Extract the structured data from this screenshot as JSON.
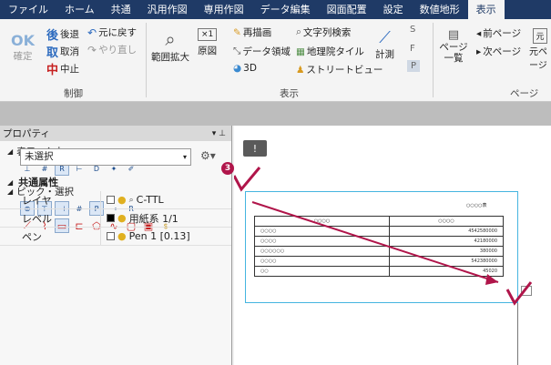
{
  "menubar": {
    "items": [
      "ファイル",
      "ホーム",
      "共通",
      "汎用作図",
      "専用作図",
      "データ編集",
      "図面配置",
      "設定",
      "数値地形",
      "表示"
    ],
    "active_index": 9
  },
  "ribbon": {
    "control": {
      "group_label": "制御",
      "ok_label": "OK",
      "confirm_label": "確定",
      "back_label": "後退",
      "undo_label": "元に戻す",
      "cancel_label": "取消",
      "redo_label": "やり直し",
      "abort_label": "中止",
      "back_mark": "後",
      "cancel_mark": "取",
      "abort_mark": "中"
    },
    "display": {
      "group_label": "表示",
      "zoom_range_label": "範囲拡大",
      "original_label": "原図",
      "original_icon_text": "×1",
      "redraw_label": "再描画",
      "text_search_label": "文字列検索",
      "data_area_label": "データ領域",
      "geo_tile_label": "地理院タイル",
      "view3d_label": "3D",
      "streetview_label": "ストリートビュー",
      "measure_label": "計測",
      "small_buttons": [
        "S",
        "F",
        "P"
      ]
    },
    "page": {
      "group_label": "ページ",
      "page_list_label": "ページ一覧",
      "prev_page_label": "前ページ",
      "next_page_label": "次ページ",
      "orig_page_label": "元ページ",
      "orig_icon_text": "元"
    }
  },
  "panel": {
    "title": "プロパティ",
    "pin_mark": "▾ ꜖",
    "display_input_label": "表示・入力",
    "pick_select_label": "ピック・選択",
    "selection_value": "未選択",
    "common_attr_label": "共通属性",
    "properties": [
      {
        "key": "レイヤ",
        "value": "C-TTL",
        "swatch": "#ffffff"
      },
      {
        "key": "レベル",
        "value": "用紙系 1/1",
        "swatch": "#000000"
      },
      {
        "key": "ペン",
        "value": "Pen 1 [0.13]",
        "swatch": "#ffffff"
      }
    ]
  },
  "canvas": {
    "callout_number": "3",
    "sheet_title": "○○○○表",
    "table_headers": [
      "○○○○",
      "○○○○"
    ],
    "table_rows": [
      [
        "○○○○",
        "4542580000"
      ],
      [
        "○○○○",
        "42180000"
      ],
      [
        "○○○○○○",
        "380000"
      ],
      [
        "○○○○",
        "542380000"
      ],
      [
        "○○",
        "45020"
      ]
    ]
  },
  "colors": {
    "menubar": "#1f3a66",
    "accent_red": "#b0154a",
    "outline_cyan": "#45b5e0"
  }
}
